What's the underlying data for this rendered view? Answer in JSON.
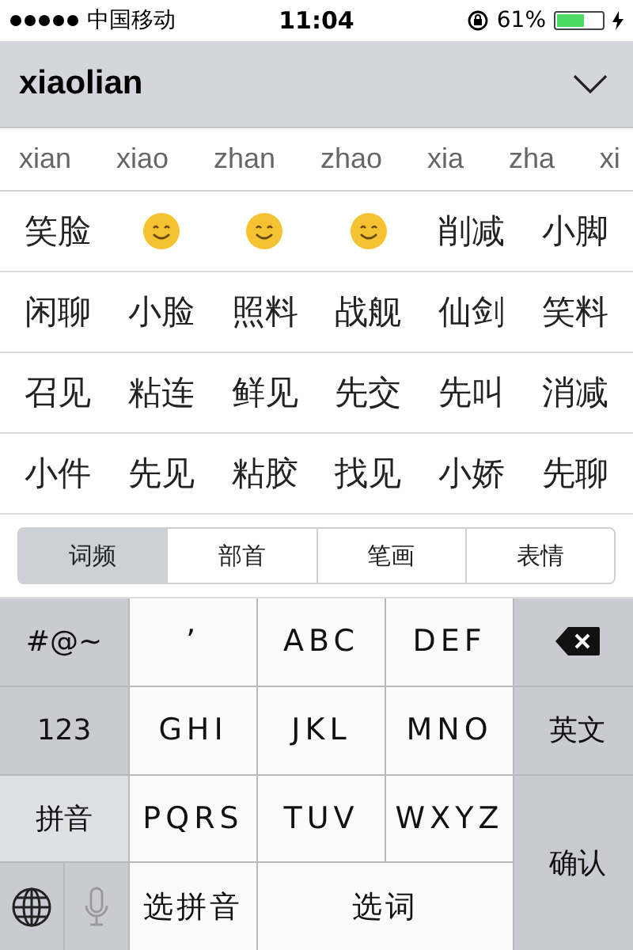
{
  "status_bar": {
    "carrier": "中国移动",
    "time": "11:04",
    "battery_text": "61%",
    "battery": {
      "level": 0.61,
      "charging": true
    }
  },
  "input": {
    "value": "xiaolian"
  },
  "pinyin_options": [
    "xian",
    "xiao",
    "zhan",
    "zhao",
    "xia",
    "zha",
    "xi"
  ],
  "candidate_rows": [
    [
      {
        "kind": "word",
        "text": "笑脸"
      },
      {
        "kind": "emoji"
      },
      {
        "kind": "emoji"
      },
      {
        "kind": "emoji"
      },
      {
        "kind": "word",
        "text": "削减"
      },
      {
        "kind": "word",
        "text": "小脚"
      }
    ],
    [
      {
        "kind": "word",
        "text": "闲聊"
      },
      {
        "kind": "word",
        "text": "小脸"
      },
      {
        "kind": "word",
        "text": "照料"
      },
      {
        "kind": "word",
        "text": "战舰"
      },
      {
        "kind": "word",
        "text": "仙剑"
      },
      {
        "kind": "word",
        "text": "笑料"
      }
    ],
    [
      {
        "kind": "word",
        "text": "召见"
      },
      {
        "kind": "word",
        "text": "粘连"
      },
      {
        "kind": "word",
        "text": "鲜见"
      },
      {
        "kind": "word",
        "text": "先交"
      },
      {
        "kind": "word",
        "text": "先叫"
      },
      {
        "kind": "word",
        "text": "消减"
      }
    ],
    [
      {
        "kind": "word",
        "text": "小件"
      },
      {
        "kind": "word",
        "text": "先见"
      },
      {
        "kind": "word",
        "text": "粘胶"
      },
      {
        "kind": "word",
        "text": "找见"
      },
      {
        "kind": "word",
        "text": "小娇"
      },
      {
        "kind": "word",
        "text": "先聊"
      }
    ]
  ],
  "sort_tabs": [
    {
      "label": "词频",
      "selected": true
    },
    {
      "label": "部首",
      "selected": false
    },
    {
      "label": "笔画",
      "selected": false
    },
    {
      "label": "表情",
      "selected": false
    }
  ],
  "keys": [
    {
      "kind": "side",
      "label": "#@~"
    },
    {
      "kind": "letter",
      "label": "’"
    },
    {
      "kind": "letter",
      "label": "ABC"
    },
    {
      "kind": "letter",
      "label": "DEF"
    },
    {
      "kind": "delete"
    },
    {
      "kind": "side",
      "label": "123"
    },
    {
      "kind": "letter",
      "label": "GHI"
    },
    {
      "kind": "letter",
      "label": "JKL"
    },
    {
      "kind": "letter",
      "label": "MNO"
    },
    {
      "kind": "side",
      "label": "英文"
    },
    {
      "kind": "side-light",
      "label": "拼音"
    },
    {
      "kind": "letter",
      "label": "PQRS"
    },
    {
      "kind": "letter",
      "label": "TUV"
    },
    {
      "kind": "letter",
      "label": "WXYZ"
    },
    {
      "kind": "confirm",
      "label": "确认"
    },
    {
      "kind": "globe"
    },
    {
      "kind": "mic"
    },
    {
      "kind": "letter-cn",
      "label": "选拼音"
    },
    {
      "kind": "wide",
      "label": "选词"
    }
  ]
}
